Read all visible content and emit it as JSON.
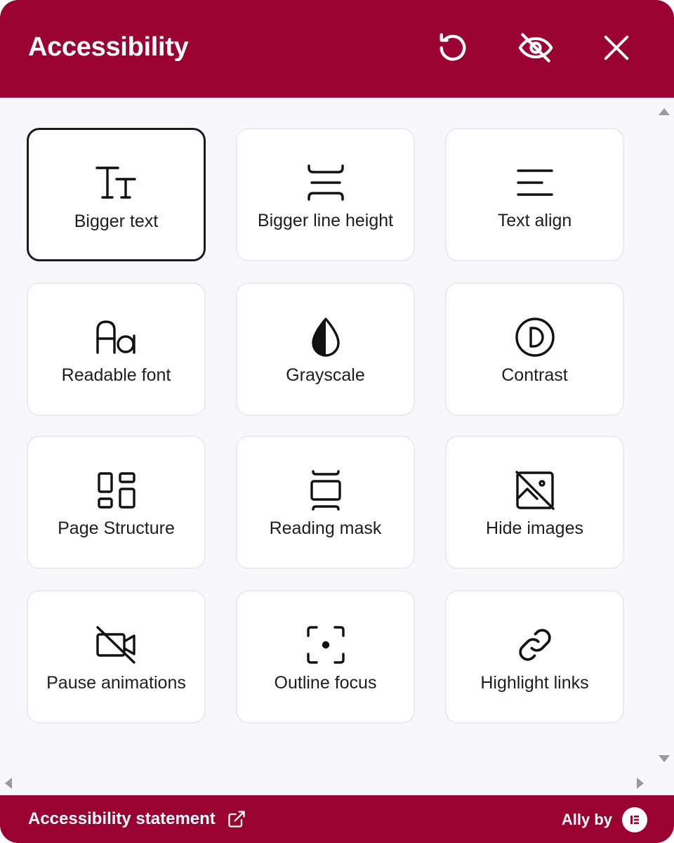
{
  "header": {
    "title": "Accessibility",
    "reset_icon": "reset-icon",
    "hide_icon": "eye-off-icon",
    "close_icon": "close-icon"
  },
  "colors": {
    "brand": "#9a0231",
    "card_bg": "#ffffff",
    "panel_bg": "#f7f8fc",
    "active_border": "#1b1b1b"
  },
  "tools": [
    {
      "label": "Bigger text",
      "icon": "text-size-icon",
      "active": true
    },
    {
      "label": "Bigger line height",
      "icon": "line-height-icon",
      "active": false
    },
    {
      "label": "Text align",
      "icon": "text-align-icon",
      "active": false
    },
    {
      "label": "Readable font",
      "icon": "font-icon",
      "active": false
    },
    {
      "label": "Grayscale",
      "icon": "drop-half-icon",
      "active": false
    },
    {
      "label": "Contrast",
      "icon": "contrast-icon",
      "active": false
    },
    {
      "label": "Page Structure",
      "icon": "page-structure-icon",
      "active": false
    },
    {
      "label": "Reading mask",
      "icon": "reading-mask-icon",
      "active": false
    },
    {
      "label": "Hide images",
      "icon": "image-off-icon",
      "active": false
    },
    {
      "label": "Pause animations",
      "icon": "video-off-icon",
      "active": false
    },
    {
      "label": "Outline focus",
      "icon": "focus-outline-icon",
      "active": false
    },
    {
      "label": "Highlight links",
      "icon": "link-icon",
      "active": false
    }
  ],
  "footer": {
    "statement_label": "Accessibility statement",
    "statement_icon": "external-link-icon",
    "brand_label": "Ally by",
    "brand_icon": "elementor-logo-icon"
  }
}
